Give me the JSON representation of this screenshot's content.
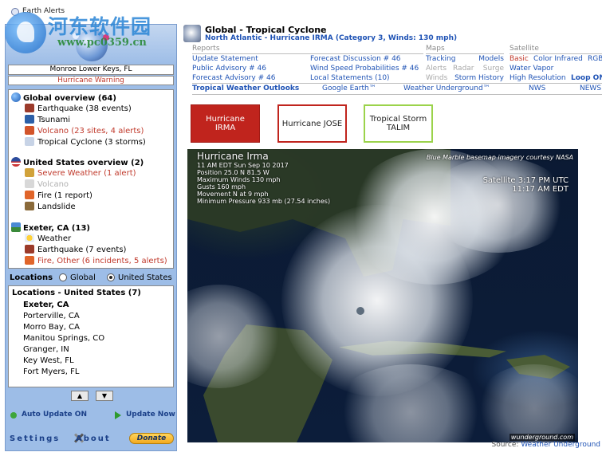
{
  "window": {
    "title": "Earth Alerts"
  },
  "watermark": {
    "text": "河东软件园",
    "url": "www.pc0359.cn"
  },
  "left": {
    "current_location": "Monroe Lower Keys, FL",
    "current_warning": "Hurricane Warning",
    "groups": [
      {
        "title": "Global overview (64)",
        "items": [
          {
            "label": "Earthquake (38 events)",
            "style": "normal"
          },
          {
            "label": "Tsunami",
            "style": "normal"
          },
          {
            "label": "Volcano (23 sites, 4 alerts)",
            "style": "red"
          },
          {
            "label": "Tropical Cyclone (3 storms)",
            "style": "selected"
          }
        ]
      },
      {
        "title": "United States overview (2)",
        "items": [
          {
            "label": "Severe Weather (1 alert)",
            "style": "red"
          },
          {
            "label": "Volcano",
            "style": "gray"
          },
          {
            "label": "Fire (1 report)",
            "style": "normal"
          },
          {
            "label": "Landslide",
            "style": "normal"
          }
        ]
      },
      {
        "title": "Exeter, CA (13)",
        "items": [
          {
            "label": "Weather",
            "style": "normal"
          },
          {
            "label": "Earthquake (7 events)",
            "style": "normal"
          },
          {
            "label": "Fire, Other (6 incidents, 5 alerts)",
            "style": "red"
          }
        ]
      }
    ],
    "locations_label": "Locations",
    "radio_global": "Global",
    "radio_us": "United States",
    "radio_selected": "United States",
    "locations_title": "Locations - United States (7)",
    "locations": [
      "Exeter, CA",
      "Porterville, CA",
      "Morro Bay, CA",
      "Manitou Springs, CO",
      "Granger, IN",
      "Key West, FL",
      "Fort Myers, FL"
    ],
    "auto_update": "Auto Update ON",
    "update_now": "Update Now",
    "settings": "Settings",
    "about": "About",
    "donate": "Donate"
  },
  "right": {
    "title": "Global - Tropical Cyclone",
    "subtitle": "North Atlantic - Hurricane IRMA (Category 3, Winds: 130 mph)",
    "reports_header": "Reports",
    "reports_col1": [
      "Update Statement",
      "Public Advisory # 46",
      "Forecast Advisory # 46"
    ],
    "reports_col2": [
      "Forecast Discussion # 46",
      "Wind Speed Probabilities # 46",
      "Local Statements (10)"
    ],
    "maps_header": "Maps",
    "maps_rows": [
      [
        "Tracking",
        "Models"
      ],
      [
        "Alerts",
        "Radar",
        "Surge"
      ],
      [
        "Winds",
        "Storm History"
      ]
    ],
    "satellite_header": "Satellite",
    "satellite_rows": [
      [
        "Basic",
        "Color Infrared",
        "RGB"
      ],
      [
        "Water Vapor"
      ],
      [
        "High Resolution",
        "Loop ON"
      ]
    ],
    "outlooks": [
      "Tropical Weather Outlooks",
      "Google Earth™",
      "Weather Underground™",
      "NWS",
      "NEWS"
    ],
    "storms": [
      {
        "line1": "Hurricane",
        "line2": "IRMA"
      },
      {
        "line1": "Hurricane JOSE",
        "line2": ""
      },
      {
        "line1": "Tropical Storm",
        "line2": "TALIM"
      }
    ],
    "image": {
      "title": "Hurricane Irma",
      "details": [
        "11 AM EDT Sun Sep 10 2017",
        "Position 25.0 N 81.5 W",
        "Maximum Winds 130 mph",
        "Gusts 160 mph",
        "Movement N at 9 mph",
        "Minimum Pressure 933 mb (27.54 inches)"
      ],
      "credit": "Blue Marble basemap imagery courtesy NASA",
      "time1": "Satellite  3:17 PM UTC",
      "time2": "11:17 AM EDT",
      "logo": "wunderground.com"
    },
    "source_label": "Source:",
    "source_link": "Weather Underground"
  },
  "colors": {
    "accent_blue": "#1f53b5",
    "alert_red": "#c0241d",
    "panel_blue": "#9dbde7",
    "talim_green": "#9bd34b"
  }
}
